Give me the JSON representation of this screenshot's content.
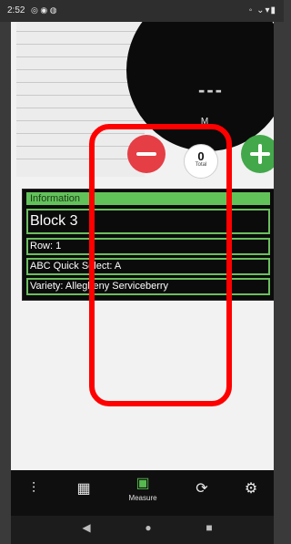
{
  "status_bar": {
    "time": "2:52",
    "left_icons": "◎ ◉ ◍",
    "right_icons": "◦ ⌄▾▮"
  },
  "dial": {
    "value": "---",
    "unit": "M"
  },
  "total": {
    "count": "0",
    "label": "Total"
  },
  "info": {
    "header": "Information",
    "block": "Block 3",
    "rows": [
      "Row: 1",
      "ABC Quick Select: A",
      "Variety: Allegheny Serviceberry"
    ]
  },
  "bottom_nav": {
    "items": [
      {
        "icon": "sliders-icon",
        "glyph": "⫶"
      },
      {
        "icon": "grid-icon",
        "glyph": "▦"
      },
      {
        "icon": "folder-icon",
        "glyph": "▣",
        "label": "Measure"
      },
      {
        "icon": "refresh-icon",
        "glyph": "⟳"
      },
      {
        "icon": "gear-icon",
        "glyph": "⚙"
      }
    ]
  },
  "system_nav": {
    "back": "◀",
    "home": "●",
    "recents": "■"
  },
  "colors": {
    "accent_green": "#56b94f",
    "minus_red": "#e53e45",
    "plus_green": "#43a84a",
    "annotation_red": "#ff0000"
  }
}
